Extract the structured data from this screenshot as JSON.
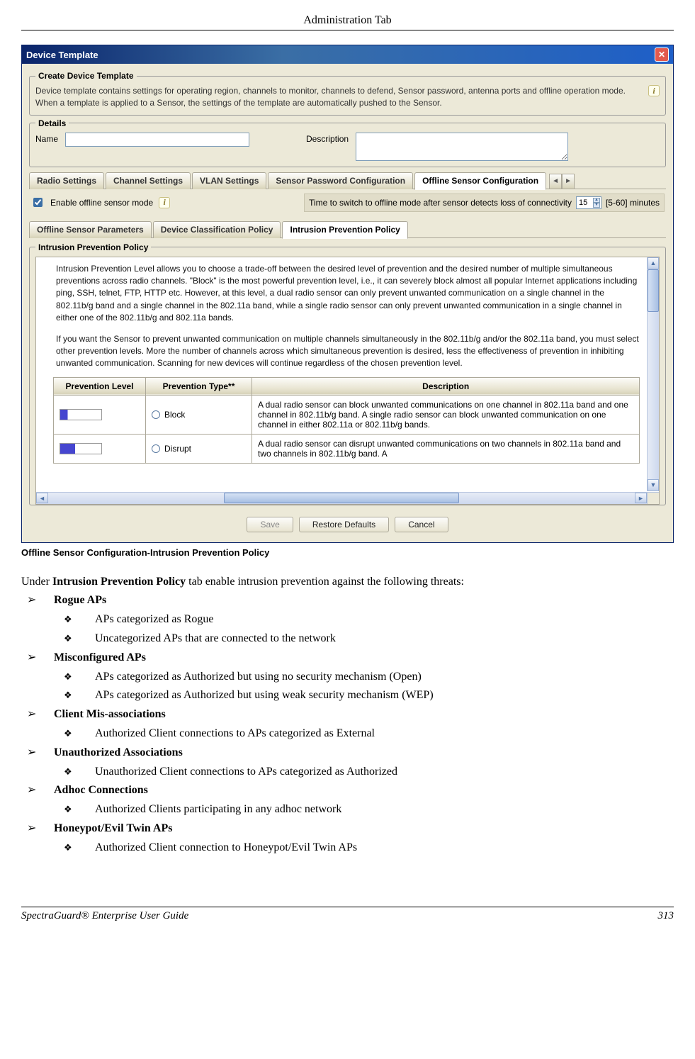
{
  "header": {
    "title": "Administration Tab"
  },
  "dialog": {
    "title": "Device Template",
    "create": {
      "legend": "Create Device Template",
      "description": "Device template contains settings for operating region, channels to monitor, channels to defend, Sensor password, antenna ports and offline operation mode. When a template is applied to a Sensor, the settings of the template are automatically pushed to the Sensor."
    },
    "details": {
      "legend": "Details",
      "name_label": "Name",
      "name_value": "",
      "desc_label": "Description",
      "desc_value": ""
    },
    "main_tabs": {
      "items": [
        "Radio Settings",
        "Channel Settings",
        "VLAN Settings",
        "Sensor Password Configuration",
        "Offline Sensor Configuration"
      ],
      "active": 4
    },
    "offline": {
      "enable_label": "Enable offline sensor mode",
      "enable_checked": true,
      "timeout_label": "Time to switch to offline mode after sensor detects loss of connectivity",
      "timeout_value": "15",
      "timeout_range": "[5-60] minutes"
    },
    "sub_tabs": {
      "items": [
        "Offline Sensor Parameters",
        "Device Classification Policy",
        "Intrusion Prevention Policy"
      ],
      "active": 2
    },
    "policy": {
      "legend": "Intrusion Prevention Policy",
      "para1": "Intrusion Prevention Level allows you to choose a trade-off between the desired level of prevention and the desired number of multiple simultaneous preventions across radio channels. \"Block\" is the most powerful prevention level, i.e., it can severely block almost all popular Internet applications including ping, SSH, telnet, FTP, HTTP etc. However, at this level, a dual radio sensor can only prevent unwanted communication on a single channel in the 802.11b/g band and a single channel in the 802.11a band, while a single radio sensor can only prevent unwanted communication in a single channel in either one of the 802.11b/g and 802.11a bands.",
      "para2": "If you want the Sensor to prevent unwanted communication on multiple channels simultaneously in the 802.11b/g and/or the 802.11a band, you must select other prevention levels. More the number of channels across which simultaneous prevention is desired, less the effectiveness of prevention in inhibiting unwanted communication. Scanning for new devices will continue regardless of the chosen prevention level.",
      "table": {
        "headers": [
          "Prevention Level",
          "Prevention Type**",
          "Description"
        ],
        "rows": [
          {
            "type": "Block",
            "desc": "A dual radio sensor can block unwanted communications on one channel in 802.11a band and one channel in 802.11b/g band. A single radio sensor can block unwanted communication on one channel in either 802.11a or 802.11b/g bands."
          },
          {
            "type": "Disrupt",
            "desc": "A dual radio sensor can disrupt unwanted communications on two channels in 802.11a band and two channels in 802.11b/g band. A"
          }
        ]
      }
    },
    "buttons": {
      "save": "Save",
      "restore": "Restore Defaults",
      "cancel": "Cancel"
    }
  },
  "caption": "Offline Sensor Configuration-Intrusion Prevention Policy",
  "doc": {
    "intro_pre": " Under ",
    "intro_bold": "Intrusion Prevention Policy",
    "intro_post": " tab enable intrusion prevention against the following threats:",
    "sections": [
      {
        "title": "Rogue APs",
        "items": [
          "APs categorized as Rogue",
          "Uncategorized APs that are connected to the network"
        ]
      },
      {
        "title": "Misconfigured APs",
        "items": [
          "APs categorized as Authorized but using no security mechanism (Open)",
          "APs categorized as Authorized but using weak security mechanism (WEP)"
        ]
      },
      {
        "title": "Client Mis-associations",
        "items": [
          "Authorized Client connections to APs categorized as External"
        ]
      },
      {
        "title": "Unauthorized Associations",
        "items": [
          "Unauthorized Client connections to APs categorized as Authorized"
        ]
      },
      {
        "title": "Adhoc Connections",
        "items": [
          "Authorized Clients participating in any adhoc network"
        ]
      },
      {
        "title": "Honeypot/Evil Twin APs",
        "items": [
          "Authorized Client connection to Honeypot/Evil Twin APs"
        ]
      }
    ]
  },
  "footer": {
    "left": "SpectraGuard®  Enterprise User Guide",
    "right": "313"
  }
}
